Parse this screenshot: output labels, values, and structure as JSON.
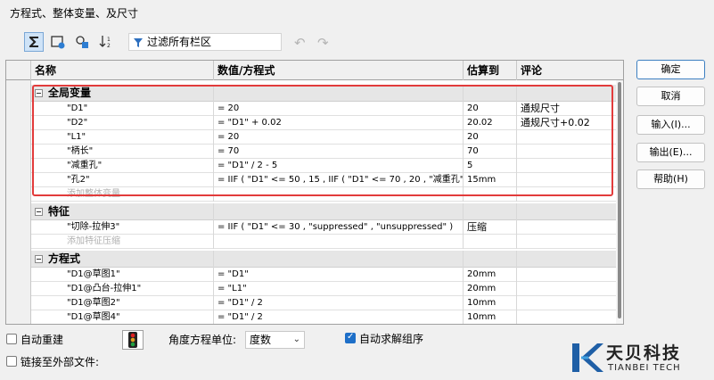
{
  "window": {
    "title": "方程式、整体变量、及尺寸"
  },
  "toolbar": {
    "buttons": [
      {
        "icon": "sigma-icon",
        "active": true
      },
      {
        "icon": "card-view-icon",
        "active": false
      },
      {
        "icon": "global-view-icon",
        "active": false
      },
      {
        "icon": "sort-order-icon",
        "active": false
      }
    ],
    "filter_value": "过滤所有栏区"
  },
  "grid": {
    "headers": [
      "名称",
      "数值/方程式",
      "估算到",
      "评论"
    ],
    "sections": [
      {
        "title": "全局变量",
        "rows": [
          {
            "name": "\"D1\"",
            "value": "= 20",
            "eval": "20",
            "comment": "通规尺寸"
          },
          {
            "name": "\"D2\"",
            "value": "= \"D1\" + 0.02",
            "eval": "20.02",
            "comment": "通规尺寸+0.02"
          },
          {
            "name": "\"L1\"",
            "value": "= 20",
            "eval": "20",
            "comment": ""
          },
          {
            "name": "\"柄长\"",
            "value": "= 70",
            "eval": "70",
            "comment": ""
          },
          {
            "name": "\"减重孔\"",
            "value": "= \"D1\" / 2 - 5",
            "eval": "5",
            "comment": ""
          },
          {
            "name": "\"孔2\"",
            "value": "= IIF ( \"D1\" <= 50 , 15 , IIF ( \"D1\" <= 70 , 20 , \"减重孔\" ) )",
            "eval": "15mm",
            "comment": ""
          }
        ],
        "add_label": "添加整体变量"
      },
      {
        "title": "特征",
        "rows": [
          {
            "name": "\"切除-拉伸3\"",
            "value": "= IIF ( \"D1\" <= 30 , \"suppressed\" , \"unsuppressed\" )",
            "eval": "压缩",
            "comment": ""
          }
        ],
        "add_label": "添加特征压缩"
      },
      {
        "title": "方程式",
        "rows": [
          {
            "name": "\"D1@草图1\"",
            "value": "= \"D1\"",
            "eval": "20mm",
            "comment": ""
          },
          {
            "name": "\"D1@凸台-拉伸1\"",
            "value": "= \"L1\"",
            "eval": "20mm",
            "comment": ""
          },
          {
            "name": "\"D1@草图2\"",
            "value": "= \"D1\" / 2",
            "eval": "10mm",
            "comment": ""
          },
          {
            "name": "\"D1@草图4\"",
            "value": "= \"D1\" / 2",
            "eval": "10mm",
            "comment": ""
          }
        ]
      }
    ]
  },
  "side_buttons": {
    "ok": "确定",
    "cancel": "取消",
    "import": "输入(I)...",
    "export": "输出(E)...",
    "help": "帮助(H)"
  },
  "bottom": {
    "auto_rebuild": {
      "label": "自动重建",
      "checked": false
    },
    "link_external": {
      "label": "链接至外部文件:",
      "checked": false
    },
    "angle_unit_label": "角度方程单位:",
    "angle_unit_value": "度数",
    "auto_solve": {
      "label": "自动求解组序",
      "checked": true
    }
  },
  "logo": {
    "cn": "天贝科技",
    "en": "TIANBEI TECH"
  },
  "colors": {
    "highlight_box": "#e23b3b",
    "accent": "#1e6fc8"
  }
}
